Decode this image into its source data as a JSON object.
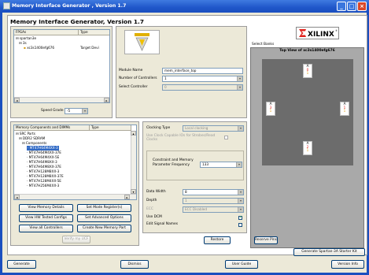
{
  "window": {
    "title": "Memory Interface Generator , Version 1.7",
    "colors": {
      "titlebar": "#1f56c9",
      "face": "#ece9d8",
      "selection": "#316ac5",
      "bank_area": "#a9a9a9",
      "bank_panel": "#6c6c6c"
    }
  },
  "heading": "Memory Interface Generator, Version 1.7",
  "fpga": {
    "col_fpgas": "FPGAs",
    "col_type": "Type",
    "tree": [
      "spartan3e",
      "3s",
      "xc3s1400efg676"
    ],
    "tree_type": "Target Devi",
    "speed_grade_label": "Speed Grade",
    "speed_grade_value": "-5"
  },
  "module": {
    "module_name_label": "Module Name",
    "module_name_value": "mem_interface_top",
    "num_controllers_label": "Number of Controllers",
    "num_controllers_value": "1",
    "select_controller_label": "Select Controller",
    "select_controller_value": "0"
  },
  "logo": {
    "brand": "XILINX",
    "trademark": "®"
  },
  "banks": {
    "select_label": "Select Banks",
    "view_title": "Top View of xc3s1400efg676",
    "top": {
      "name": "A",
      "num": "0",
      "sub": "1"
    },
    "left": {
      "name": "A",
      "num": "3",
      "sub": "1"
    },
    "right": {
      "name": "A",
      "num": "1",
      "sub": "1"
    },
    "bottom": {
      "name": "A",
      "num": "2",
      "sub": "1"
    },
    "reserve_pins": "Reserve Pins"
  },
  "components": {
    "col_name": "Memory Components and DIMMs",
    "col_type": "Type",
    "tree": [
      "SRC Parts",
      "DDR2 SDRAM",
      "Components",
      "MT47H64M4XX-3",
      "MT47H64M4XX-37E",
      "MT47H64M4XX-5E",
      "MT47H64M8XX-3",
      "MT47H64M8XX-37E",
      "MT47H128M8XX-3",
      "MT47H128M8XX-37E",
      "MT47H128M4XX-5E",
      "MT47H256M4XX-3"
    ]
  },
  "clocking": {
    "clocking_type_label": "Clocking Type",
    "clocking_type_value": "Local clocking",
    "use_clock_capable_label": "Use Clock Capable IOs for Strobes/Read Clocks",
    "constraint_label": "Constraint and Memory Parameter Frequency",
    "constraint_value": "133",
    "data_width_label": "Data Width",
    "data_width_value": "8",
    "depth_label": "Depth",
    "depth_value": "1",
    "ecc_label": "ECC",
    "ecc_value": "ECC Disabled",
    "use_dcm_label": "Use DCM",
    "use_dcm_checked": true,
    "edit_signal_names_label": "Edit Signal Names",
    "edit_signal_names_checked": false
  },
  "buttons": {
    "view_memory_details": "View Memory Details",
    "set_mode_registers": "Set Mode Register(s)",
    "view_hw_tested": "View HW Tested Configs",
    "set_advanced_options": "Set Advanced Options",
    "view_all_controllers": "View all Controllers",
    "create_new_memory_part": "Create New Memory Part",
    "verify_ucf": "Verify my UCF",
    "restore": "Restore",
    "generate_spartan": "Generate Spartan-3A Starter Kit"
  },
  "bottom": {
    "generate": "Generate",
    "dismiss": "Dismiss",
    "user_guide": "User Guide",
    "version_info": "Version Info"
  }
}
